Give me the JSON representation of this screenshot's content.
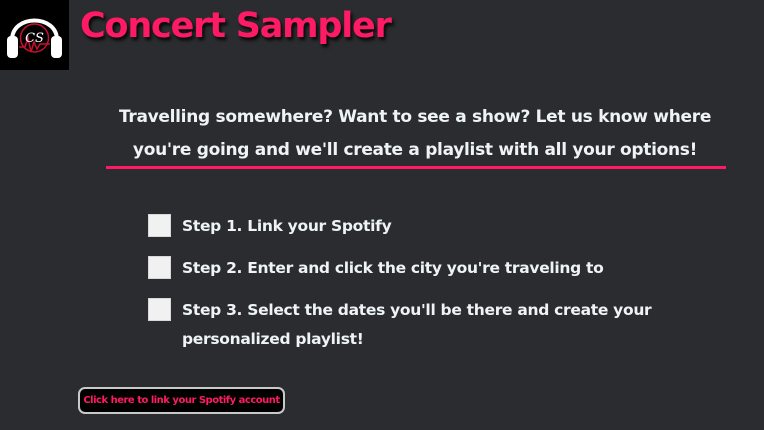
{
  "header": {
    "title": "Concert Sampler",
    "logo_icon": "headphones-logo-icon",
    "logo_text": "CS"
  },
  "intro": {
    "text": "Travelling somewhere? Want to see a show? Let us know where you're going and we'll create a playlist with all your options!"
  },
  "steps": [
    {
      "label": "Step 1. Link your Spotify",
      "checked": false
    },
    {
      "label": "Step 2. Enter and click the city you're traveling to",
      "checked": false
    },
    {
      "label": "Step 3. Select the dates you'll be there and create your personalized playlist!",
      "checked": false
    }
  ],
  "actions": {
    "link_spotify_label": "Click here to link your Spotify account"
  },
  "colors": {
    "accent": "#ff1a66",
    "background": "#2b2c2f",
    "text": "#eef4f4",
    "checkbox": "#f1f1f1"
  }
}
